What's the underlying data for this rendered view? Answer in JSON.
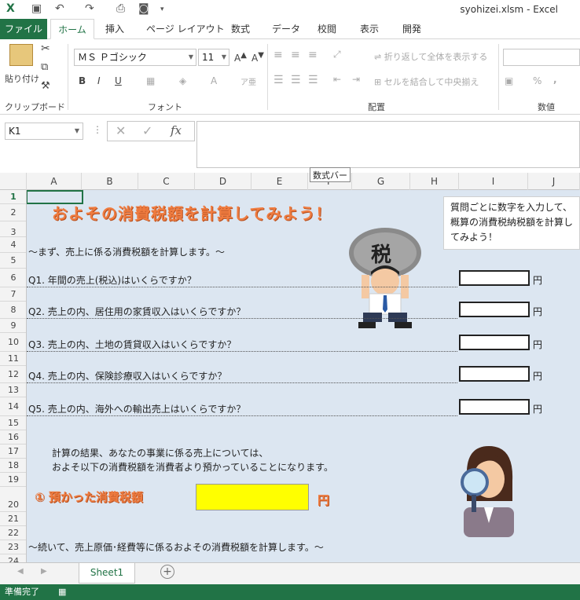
{
  "app": {
    "filename": "syohizei.xlsm - Excel"
  },
  "tabs": [
    "ファイル",
    "ホーム",
    "挿入",
    "ページ レイアウト",
    "数式",
    "データ",
    "校閲",
    "表示",
    "開発"
  ],
  "ribbon": {
    "paste_label": "貼り付け",
    "clipboard_label": "クリップボード",
    "font_name": "ＭＳ Ｐゴシック",
    "font_size": "11",
    "font_group_label": "フォント",
    "wrap_text": "折り返して全体を表示する",
    "merge_center": "セルを結合して中央揃え",
    "align_group_label": "配置",
    "number_group_label": "数値",
    "bold": "B",
    "italic": "I",
    "underline": "U",
    "percent": "%",
    "comma": ","
  },
  "formula_bar": {
    "name_box": "K1",
    "fx": "fx",
    "tooltip": "数式バー"
  },
  "columns": [
    "A",
    "B",
    "C",
    "D",
    "E",
    "F",
    "G",
    "H",
    "I",
    "J"
  ],
  "rows": [
    "1",
    "2",
    "3",
    "4",
    "5",
    "6",
    "7",
    "8",
    "9",
    "10",
    "11",
    "12",
    "13",
    "14",
    "15",
    "16",
    "17",
    "18",
    "19",
    "20",
    "21",
    "22",
    "23",
    "24"
  ],
  "sheet": {
    "title": "およその消費税額を計算してみよう！",
    "note": "質問ごとに数字を入力して、概算の消費税納税額を計算してみよう！",
    "intro": "～まず、売上に係る消費税額を計算します。～",
    "questions": [
      "Q1.  年間の売上(税込)はいくらですか？",
      "Q2.  売上の内、居住用の家賃収入はいくらですか？",
      "Q3.  売上の内、土地の賃貸収入はいくらですか？",
      "Q4.  売上の内、保険診療収入はいくらですか？",
      "Q5.  売上の内、海外への輸出売上はいくらですか？"
    ],
    "yen": "円",
    "result_line1": "計算の結果、あなたの事業に係る売上については、",
    "result_line2": "およそ以下の消費税額を消費者より預かっていることになります。",
    "result_title": "①  預かった消費税額",
    "result_yen": "円",
    "outro": "～続いて、売上原価･経費等に係るおよその消費税額を計算します。～",
    "bag_label": "税"
  },
  "sheet_tab": "Sheet1",
  "status": "準備完了",
  "colors": {
    "excel_green": "#217346",
    "sheet_bg": "#dce6f1",
    "title_orange": "#ef7c40",
    "highlight_yellow": "#ffff00"
  }
}
